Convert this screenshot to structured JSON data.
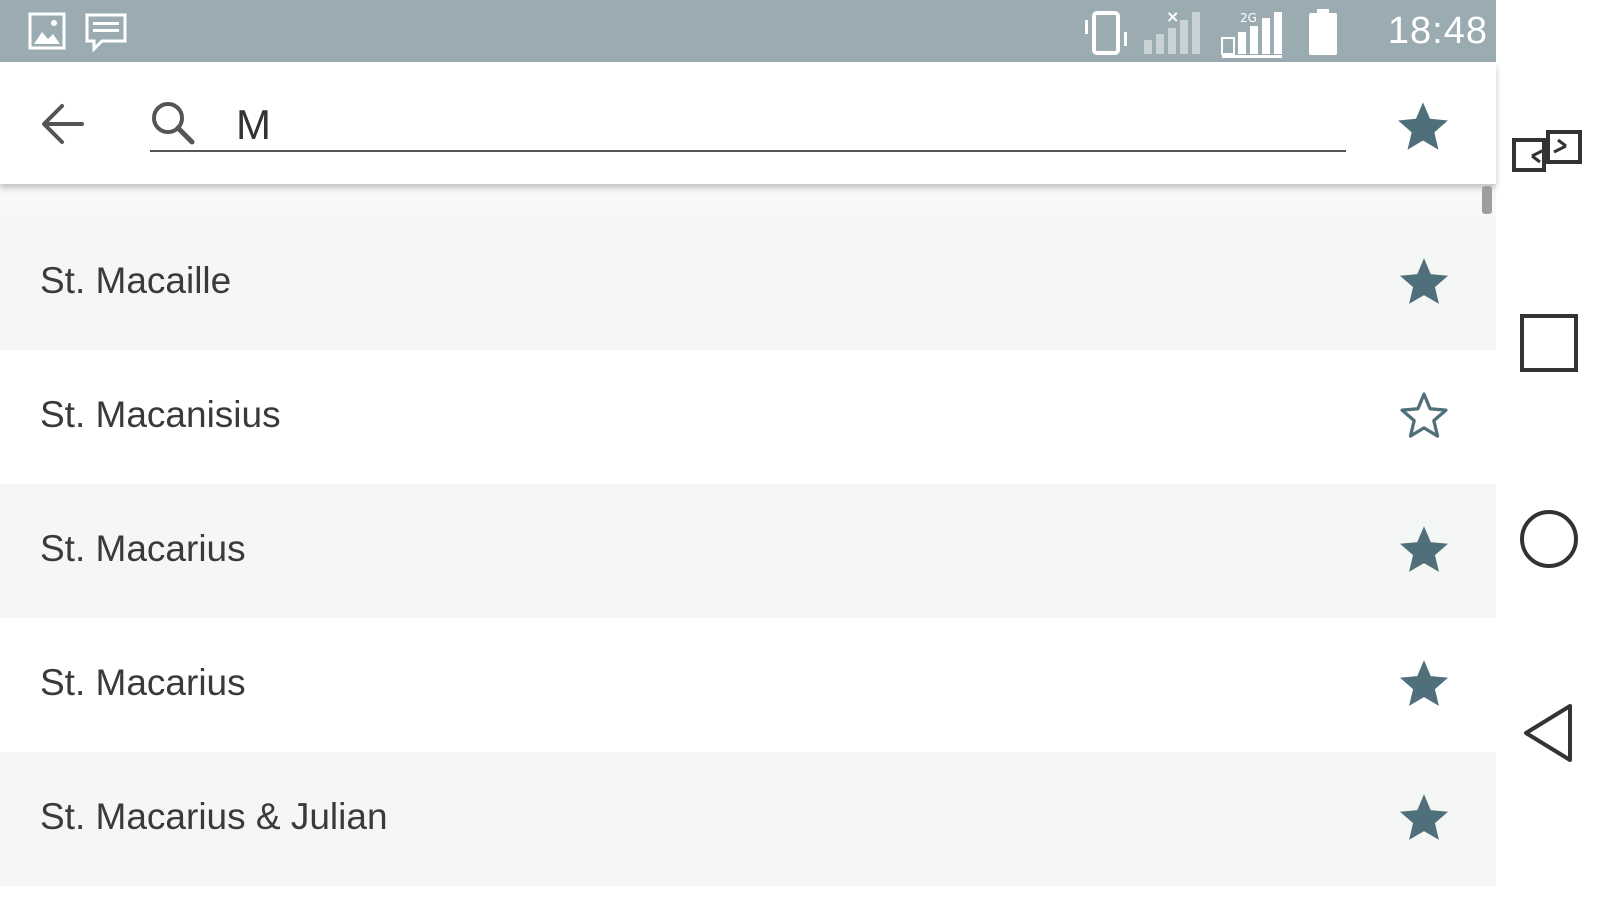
{
  "status_bar": {
    "time": "18:48",
    "network_label": "2G",
    "icons": [
      "gallery-icon",
      "message-icon",
      "vibrate-icon",
      "signal-no-sim-icon",
      "signal-icon",
      "battery-icon"
    ]
  },
  "search": {
    "value": "M",
    "back_icon": "back-arrow-icon",
    "search_icon": "search-icon",
    "favorites_icon": "star-filled-icon"
  },
  "list": {
    "items": [
      {
        "label": "St. Macaille",
        "favorite": true
      },
      {
        "label": "St. Macanisius",
        "favorite": false
      },
      {
        "label": "St. Macarius",
        "favorite": true
      },
      {
        "label": "St. Macarius",
        "favorite": true
      },
      {
        "label": "St. Macarius & Julian",
        "favorite": true
      }
    ]
  },
  "nav_bar": {
    "icons": [
      "dual-window-icon",
      "recents-icon",
      "home-icon",
      "back-icon"
    ]
  },
  "colors": {
    "status_bar": "#9aabb1",
    "star": "#4f6f7a",
    "list_alt_row": "#f5f7f7",
    "text": "#3a3a3a"
  }
}
